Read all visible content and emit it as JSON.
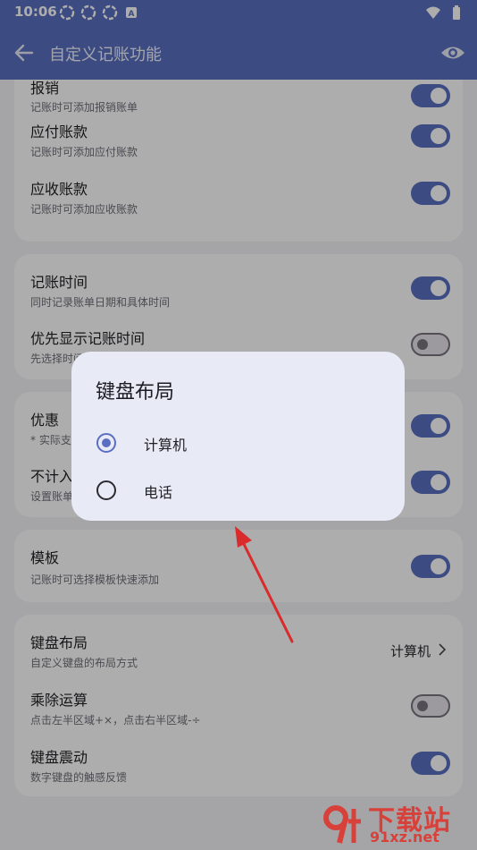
{
  "status_bar": {
    "time": "10:06"
  },
  "app_bar": {
    "title": "自定义记账功能"
  },
  "cards": {
    "card1": [
      {
        "title": "报销",
        "subtitle": "记账时可添加报销账单",
        "toggle": true
      },
      {
        "title": "应付账款",
        "subtitle": "记账时可添加应付账款",
        "toggle": true
      },
      {
        "title": "应收账款",
        "subtitle": "记账时可添加应收账款",
        "toggle": true
      }
    ],
    "card2": [
      {
        "title": "记账时间",
        "subtitle": "同时记录账单日期和具体时间",
        "toggle": true
      },
      {
        "title": "优先显示记账时间",
        "subtitle": "先选择时间",
        "toggle": false
      }
    ],
    "card3": [
      {
        "title": "优惠",
        "subtitle": "* 实际支",
        "toggle": true
      },
      {
        "title": "不计入",
        "subtitle": "设置账单",
        "toggle": true
      }
    ],
    "card4": [
      {
        "title": "模板",
        "subtitle": "记账时可选择模板快速添加",
        "toggle": true
      }
    ],
    "card5": [
      {
        "title": "键盘布局",
        "subtitle": "自定义键盘的布局方式",
        "value": "计算机"
      },
      {
        "title": "乘除运算",
        "subtitle": "点击左半区域+×，点击右半区域-÷",
        "toggle": false
      },
      {
        "title": "键盘震动",
        "subtitle": "数字键盘的触感反馈",
        "toggle": true
      }
    ]
  },
  "dialog": {
    "title": "键盘布局",
    "options": [
      {
        "label": "计算机",
        "selected": true
      },
      {
        "label": "电话",
        "selected": false
      }
    ]
  },
  "watermark": {
    "line1": "下载站",
    "line2": "91xz.net",
    "logo": "9f"
  },
  "colors": {
    "primary": "#5a6fc2",
    "card_bg": "#ffffff",
    "page_bg": "#f3f3f8",
    "dialog_bg": "#e8eaf6",
    "annotation_arrow": "#d92b2b"
  }
}
